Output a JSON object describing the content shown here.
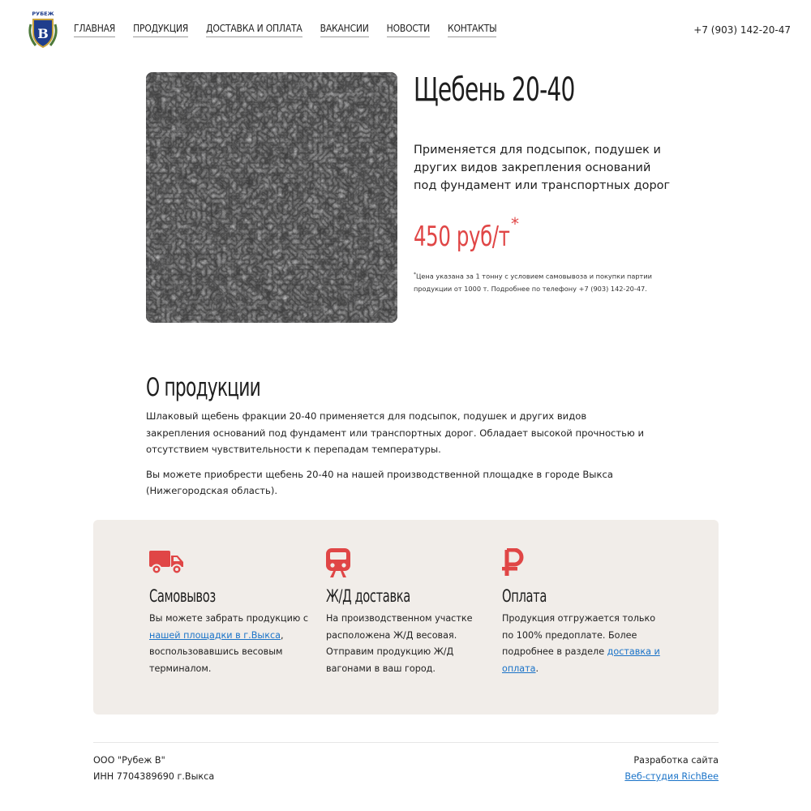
{
  "header": {
    "logo_text": "РУБЕЖ",
    "logo_letter": "В",
    "nav": [
      {
        "label": "ГЛАВНАЯ"
      },
      {
        "label": "ПРОДУКЦИЯ"
      },
      {
        "label": "ДОСТАВКА И ОПЛАТА"
      },
      {
        "label": "ВАКАНСИИ"
      },
      {
        "label": "НОВОСТИ"
      },
      {
        "label": "КОНТАКТЫ"
      }
    ],
    "phone": "+7 (903) 142-20-47"
  },
  "product": {
    "title": "Щебень 20-40",
    "description": "Применяется для подсыпок, подушек и других видов закрепления оснований под фундамент или транспортных дорог",
    "price": "450 руб/т",
    "price_mark": "*",
    "note_mark": "*",
    "note": "Цена указана за 1 тонну с условием самовывоза и покупки партии продукции от 1000 т. Подробнее по телефону +7 (903) 142-20-47.",
    "price_color": "#e04646"
  },
  "about": {
    "title": "О продукции",
    "paragraph1": "Шлаковый щебень фракции 20-40 применяется для подсыпок, подушек и других видов закрепления оснований под фундамент или транспортных дорог. Обладает высокой прочностью и отсутствием чувствительности к перепадам температуры.",
    "paragraph2": "Вы можете приобрести щебень 20-40 на нашей производственной площадке в городе Выкса (Нижегородская область)."
  },
  "features": [
    {
      "icon": "truck-icon",
      "title": "Самовывоз",
      "text_before": "Вы можете забрать продукцию с ",
      "link": "нашей площадки в г.Выкса",
      "text_after": ", воспользовавшись весовым терминалом."
    },
    {
      "icon": "train-icon",
      "title": "Ж/Д доставка",
      "text": "На производственном участке расположена Ж/Д весовая. Отправим продукцию Ж/Д вагонами в ваш город."
    },
    {
      "icon": "ruble-icon",
      "title": "Оплата",
      "text_before": "Продукция отгружается только по 100% предоплате. Более подробнее в разделе ",
      "link": "доставка и оплата",
      "text_after": "."
    }
  ],
  "footer": {
    "company": "ООО \"Рубеж В\"",
    "inn": "ИНН 7704389690 г.Выкса",
    "dev_label": "Разработка сайта",
    "dev_link": "Веб-студия RichBee"
  },
  "colors": {
    "accent_red": "#e04646",
    "link_blue": "#1a73c8",
    "features_bg": "#f1ede9"
  }
}
